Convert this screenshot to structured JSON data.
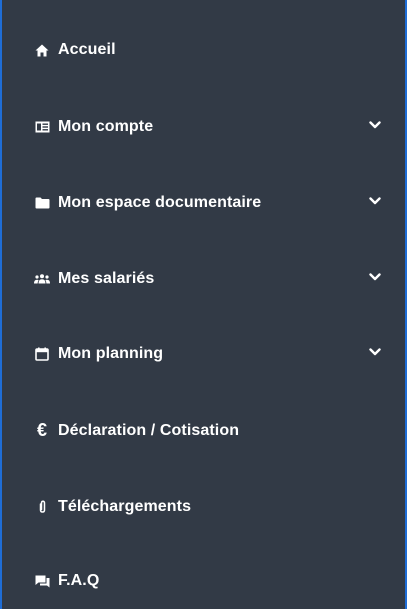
{
  "sidebar": {
    "items": [
      {
        "label": "Accueil",
        "icon": "home-icon",
        "expandable": false
      },
      {
        "label": "Mon compte",
        "icon": "account-card-icon",
        "expandable": true
      },
      {
        "label": "Mon espace documentaire",
        "icon": "folder-icon",
        "expandable": true
      },
      {
        "label": "Mes salariés",
        "icon": "people-icon",
        "expandable": true
      },
      {
        "label": "Mon planning",
        "icon": "calendar-icon",
        "expandable": true
      },
      {
        "label": "Déclaration / Cotisation",
        "icon": "euro-icon",
        "expandable": false
      },
      {
        "label": "Téléchargements",
        "icon": "paperclip-icon",
        "expandable": false
      },
      {
        "label": "F.A.Q",
        "icon": "chat-bubbles-icon",
        "expandable": false
      }
    ],
    "euro_symbol": "€",
    "colors": {
      "background": "#323a46",
      "border": "#1f6dd6",
      "text": "#ffffff"
    }
  }
}
